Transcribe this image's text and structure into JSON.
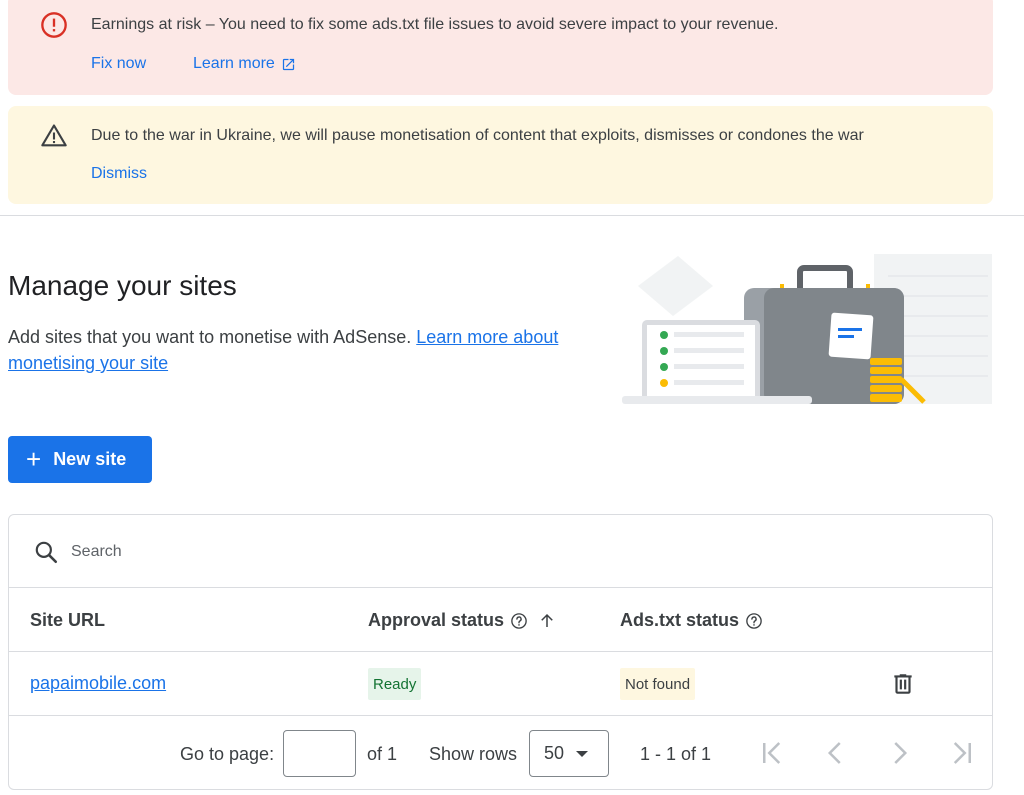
{
  "banners": {
    "error": {
      "icon": "error-circle-icon",
      "text": "Earnings at risk – You need to fix some ads.txt file issues to avoid severe impact to your revenue.",
      "fix_now": "Fix now",
      "learn_more": "Learn more",
      "color": "#d93025"
    },
    "warning": {
      "icon": "warning-triangle-icon",
      "text": "Due to the war in Ukraine, we will pause monetisation of content that exploits, dismisses or condones the war",
      "dismiss": "Dismiss"
    }
  },
  "page": {
    "title": "Manage your sites",
    "description": "Add sites that you want to monetise with AdSense.",
    "learn_more_link": "Learn more about monetising your site",
    "new_site_label": "New site"
  },
  "table": {
    "search_placeholder": "Search",
    "columns": {
      "site_url": "Site URL",
      "approval_status": "Approval status",
      "ads_txt_status": "Ads.txt status"
    },
    "rows": [
      {
        "site_url": "papaimobile.com",
        "approval_status": "Ready",
        "ads_txt_status": "Not found"
      }
    ]
  },
  "pagination": {
    "go_to_page_label": "Go to page:",
    "page_value": "",
    "of_pages": "of 1",
    "show_rows_label": "Show rows",
    "rows_value": "50",
    "range_text": "1 - 1 of 1"
  },
  "colors": {
    "accent": "#1a73e8",
    "error_bg": "#fce8e6",
    "warning_bg": "#fef7e0",
    "ready_bg": "#e6f4ea",
    "ready_text": "#137333"
  }
}
